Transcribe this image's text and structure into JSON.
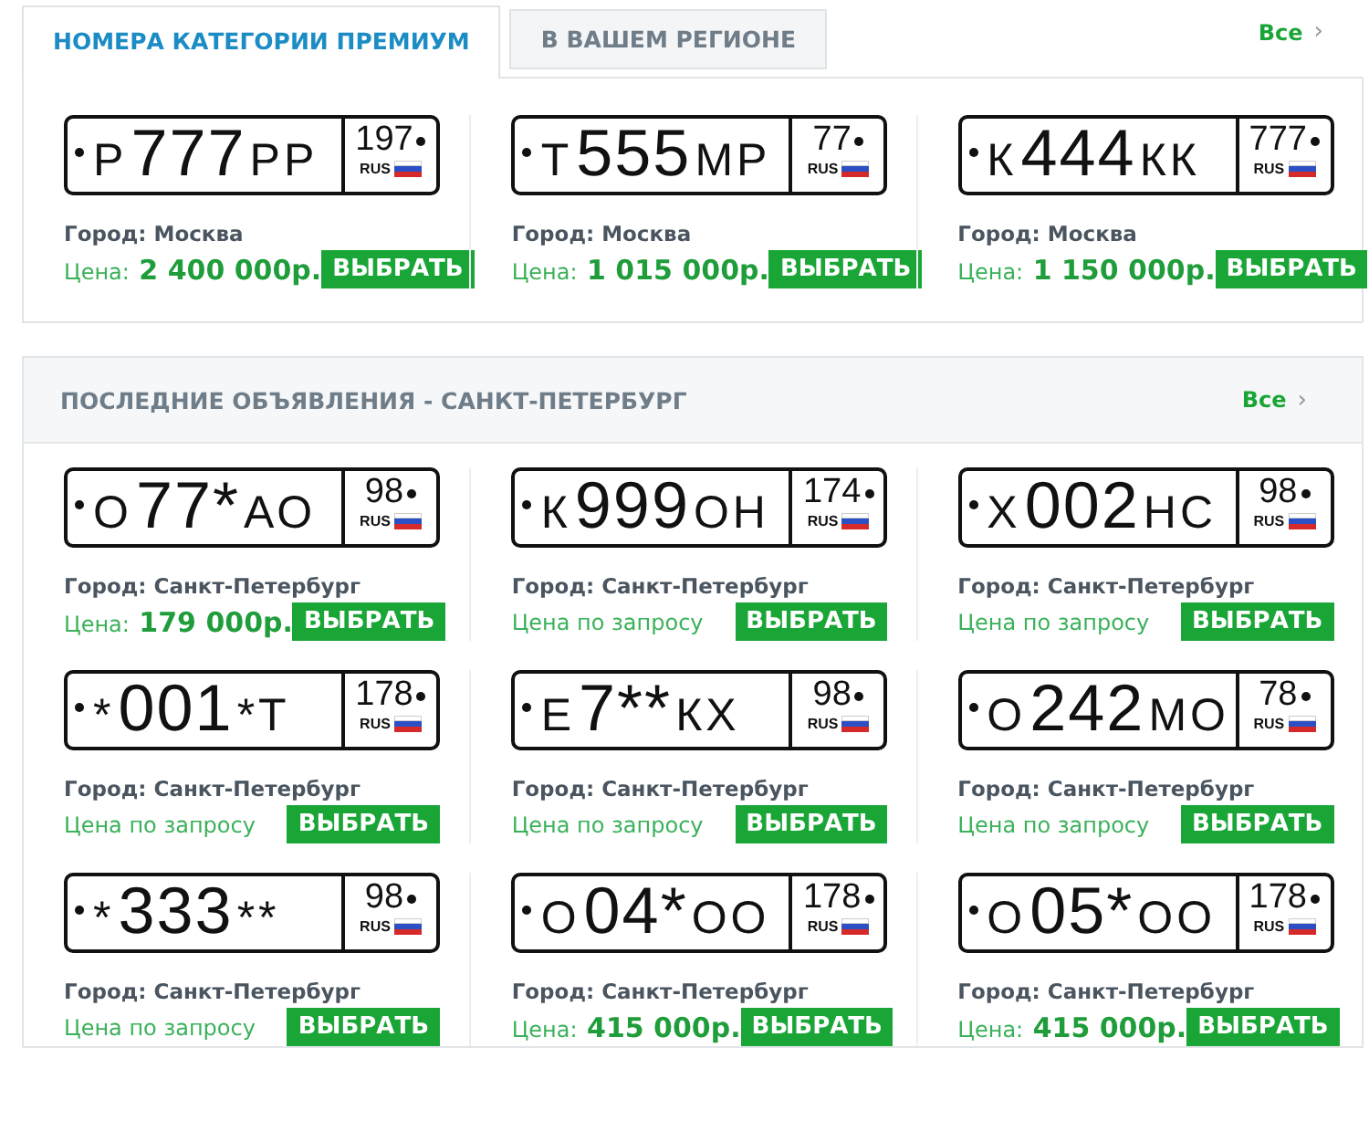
{
  "premium": {
    "tabs": [
      {
        "label": "НОМЕРА КАТЕГОРИИ ПРЕМИУМ",
        "selected": true
      },
      {
        "label": "В ВАШЕМ РЕГИОНЕ",
        "selected": false
      }
    ],
    "all_link": {
      "label": "Все",
      "chevron": "›"
    },
    "items": [
      {
        "plate": {
          "letter": "Р",
          "number": "777",
          "letters": "РР",
          "region": "197",
          "country": "RUS"
        },
        "city": "Город: Москва",
        "price": {
          "label": "Цена:",
          "value": "2 400 000р."
        },
        "button": "ВЫБРАТЬ"
      },
      {
        "plate": {
          "letter": "Т",
          "number": "555",
          "letters": "МР",
          "region": "77",
          "country": "RUS"
        },
        "city": "Город: Москва",
        "price": {
          "label": "Цена:",
          "value": "1 015 000р."
        },
        "button": "ВЫБРАТЬ"
      },
      {
        "plate": {
          "letter": "К",
          "number": "444",
          "letters": "КК",
          "region": "777",
          "country": "RUS"
        },
        "city": "Город: Москва",
        "price": {
          "label": "Цена:",
          "value": "1 150 000р."
        },
        "button": "ВЫБРАТЬ"
      }
    ]
  },
  "latest": {
    "title": "ПОСЛЕДНИЕ ОБЪЯВЛЕНИЯ - САНКТ-ПЕТЕРБУРГ",
    "all_link": {
      "label": "Все",
      "chevron": "›"
    },
    "items": [
      {
        "plate": {
          "letter": "О",
          "number": "77*",
          "letters": "АО",
          "region": "98",
          "country": "RUS"
        },
        "city": "Город: Санкт-Петербург",
        "price": {
          "label": "Цена:",
          "value": "179 000р."
        },
        "button": "ВЫБРАТЬ"
      },
      {
        "plate": {
          "letter": "К",
          "number": "999",
          "letters": "ОН",
          "region": "174",
          "country": "RUS"
        },
        "city": "Город: Санкт-Петербург",
        "price": {
          "label": "Цена по запросу"
        },
        "button": "ВЫБРАТЬ"
      },
      {
        "plate": {
          "letter": "Х",
          "number": "002",
          "letters": "НС",
          "region": "98",
          "country": "RUS"
        },
        "city": "Город: Санкт-Петербург",
        "price": {
          "label": "Цена по запросу"
        },
        "button": "ВЫБРАТЬ"
      },
      {
        "plate": {
          "letter": "*",
          "number": "001",
          "letters": "*Т",
          "region": "178",
          "country": "RUS"
        },
        "city": "Город: Санкт-Петербург",
        "price": {
          "label": "Цена по запросу"
        },
        "button": "ВЫБРАТЬ"
      },
      {
        "plate": {
          "letter": "Е",
          "number": "7**",
          "letters": "КХ",
          "region": "98",
          "country": "RUS"
        },
        "city": "Город: Санкт-Петербург",
        "price": {
          "label": "Цена по запросу"
        },
        "button": "ВЫБРАТЬ"
      },
      {
        "plate": {
          "letter": "О",
          "number": "242",
          "letters": "МО",
          "region": "78",
          "country": "RUS"
        },
        "city": "Город: Санкт-Петербург",
        "price": {
          "label": "Цена по запросу"
        },
        "button": "ВЫБРАТЬ"
      },
      {
        "plate": {
          "letter": "*",
          "number": "333",
          "letters": "**",
          "region": "98",
          "country": "RUS"
        },
        "city": "Город: Санкт-Петербург",
        "price": {
          "label": "Цена по запросу"
        },
        "button": "ВЫБРАТЬ"
      },
      {
        "plate": {
          "letter": "О",
          "number": "04*",
          "letters": "ОО",
          "region": "178",
          "country": "RUS"
        },
        "city": "Город: Санкт-Петербург",
        "price": {
          "label": "Цена:",
          "value": "415 000р."
        },
        "button": "ВЫБРАТЬ"
      },
      {
        "plate": {
          "letter": "О",
          "number": "05*",
          "letters": "ОО",
          "region": "178",
          "country": "RUS"
        },
        "city": "Город: Санкт-Петербург",
        "price": {
          "label": "Цена:",
          "value": "415 000р."
        },
        "button": "ВЫБРАТЬ"
      }
    ]
  }
}
